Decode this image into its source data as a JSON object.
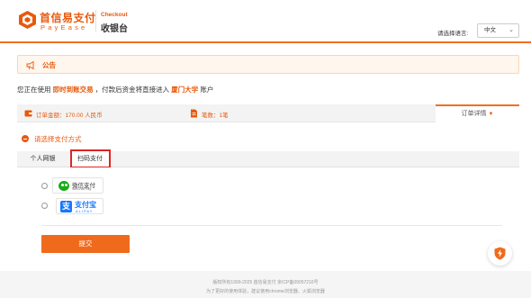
{
  "header": {
    "brand_cn": "首信易支付",
    "brand_en": "PayEase",
    "checkout_en": "Checkout",
    "checkout_cn": "收银台",
    "lang_label": "请选择语言:",
    "lang_value": "中文",
    "accent_color": "#e8590c"
  },
  "notice": {
    "label": "公告"
  },
  "intro": {
    "prefix": "您正在使用",
    "mode": "即时到账交易",
    "middle": "，付款后资金将直接进入",
    "merchant": "厦门大学",
    "suffix": "账户"
  },
  "order": {
    "amount": "订单金额：170.00 人民币",
    "count": "笔数：1笔",
    "detail_label": "订单详情"
  },
  "payment": {
    "title": "请选择支付方式",
    "tabs": [
      "个人网银",
      "扫码支付"
    ],
    "active_tab": "扫码支付",
    "options": [
      {
        "name": "微信支付",
        "sub": "WeChat Pay",
        "icon": "wechat-pay-logo"
      },
      {
        "name": "支付宝",
        "sub": "ALIPAY",
        "icon": "alipay-logo"
      }
    ],
    "submit_label": "提交"
  },
  "footer": {
    "copyright": "版权所有1999-2025 首信易支付 京ICP备09057216号",
    "browser_hint": "为了更好的使用体验，建议使用chrome浏览器、火狐浏览器"
  }
}
